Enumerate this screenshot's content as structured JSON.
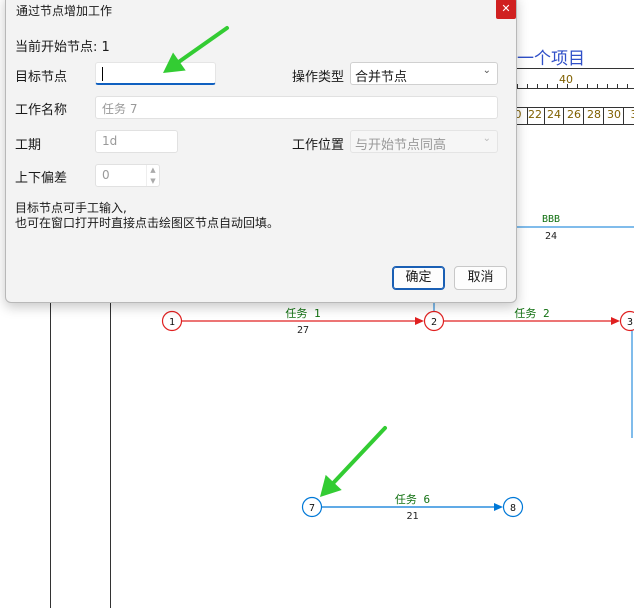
{
  "dialog": {
    "title": "通过节点增加工作",
    "close_symbol": "✕",
    "current_start_label": "当前开始节点: 1",
    "target_node_label": "目标节点",
    "target_node_value": "",
    "operation_type_label": "操作类型",
    "operation_type_value": "合并节点",
    "work_name_label": "工作名称",
    "work_name_placeholder": "任务 7",
    "duration_label": "工期",
    "duration_placeholder": "1d",
    "work_position_label": "工作位置",
    "work_position_value": "与开始节点同高",
    "offset_label": "上下偏差",
    "offset_value": "0",
    "hint_line1": "目标节点可手工输入,",
    "hint_line2": "也可在窗口打开时直接点击绘图区节点自动回填。",
    "ok_button": "确定",
    "cancel_button": "取消"
  },
  "canvas": {
    "project_title": "一个项目",
    "timescale_major": "40",
    "timescale_days": [
      "0",
      "22",
      "24",
      "26",
      "28",
      "30",
      "3"
    ],
    "activities": [
      {
        "name": "BBB",
        "duration": "24",
        "color": "#0078d7"
      },
      {
        "name": "任务 1",
        "duration": "27",
        "from": "1",
        "to": "2",
        "color": "#e02020"
      },
      {
        "name": "任务 2",
        "duration": "",
        "from": "2",
        "to": "3",
        "color": "#e02020"
      },
      {
        "name": "任务 6",
        "duration": "21",
        "from": "7",
        "to": "8",
        "color": "#0078d7"
      }
    ],
    "nodes": [
      "1",
      "2",
      "3",
      "7",
      "8"
    ],
    "colors": {
      "critical": "#e02020",
      "normal": "#0078d7",
      "label": "#107010",
      "annotation_arrow": "#33cc33"
    }
  }
}
